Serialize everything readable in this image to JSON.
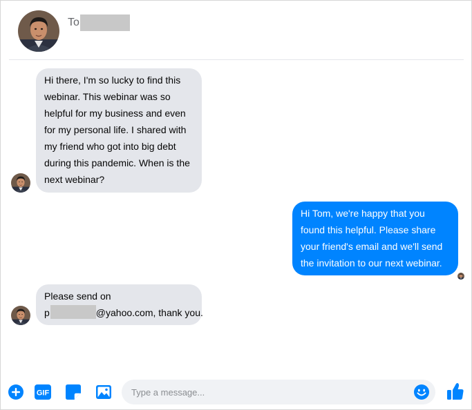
{
  "header": {
    "contact_name_visible": "To",
    "avatar_icon": "contact-avatar"
  },
  "messages": [
    {
      "direction": "incoming",
      "lines": [
        "Hi there, I'm so lucky to find this",
        "webinar. This webinar was so",
        "helpful for my business and even",
        "for my personal life. I shared with",
        "my friend who got into big debt",
        "during this pandemic. When is the",
        "next webinar?"
      ]
    },
    {
      "direction": "outgoing",
      "lines": [
        "Hi Tom, we're happy that you",
        "found this helpful. Please share",
        "your friend's email and we'll send",
        "the invitation to our next webinar."
      ]
    },
    {
      "direction": "incoming",
      "lines": [
        "Please send on",
        "p",
        "@yahoo.com, thank you."
      ]
    }
  ],
  "composer": {
    "placeholder": "Type a message...",
    "gif_label": "GIF",
    "icons": [
      "add-icon",
      "gif-icon",
      "sticker-icon",
      "image-icon",
      "emoji-icon",
      "thumbs-up-icon"
    ]
  },
  "colors": {
    "accent": "#0084ff",
    "incoming_bubble": "#e4e6eb",
    "outgoing_bubble": "#0084ff"
  }
}
